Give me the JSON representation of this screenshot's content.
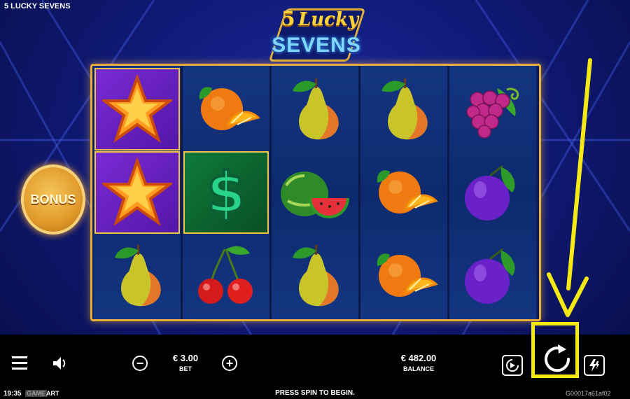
{
  "window": {
    "title": "5 LUCKY SEVENS"
  },
  "logo": {
    "five": "5",
    "lucky": "Lucky",
    "sevens": "SEVENS"
  },
  "bonus": {
    "label": "BONUS"
  },
  "reels": [
    [
      "star-icon",
      "star-icon",
      "pear-icon"
    ],
    [
      "orange-icon",
      "dollar-icon",
      "cherry-icon"
    ],
    [
      "pear-icon",
      "watermelon-icon",
      "pear-icon"
    ],
    [
      "pear-icon",
      "orange-icon",
      "orange-icon"
    ],
    [
      "grapes-icon",
      "plum-icon",
      "plum-icon"
    ]
  ],
  "controls": {
    "bet_value": "€ 3.00",
    "bet_label": "BET",
    "balance_value": "€ 482.00",
    "balance_label": "BALANCE",
    "minus_glyph": "−",
    "plus_glyph": "+"
  },
  "footer": {
    "time": "19:35",
    "brand_left": "GAME",
    "brand_right": "ART",
    "message": "PRESS SPIN TO BEGIN.",
    "round_id": "G00017a61af02"
  },
  "colors": {
    "accent_gold": "#e9ae3a",
    "highlight_yellow": "#f4ea12",
    "background_blue": "#101a78"
  }
}
